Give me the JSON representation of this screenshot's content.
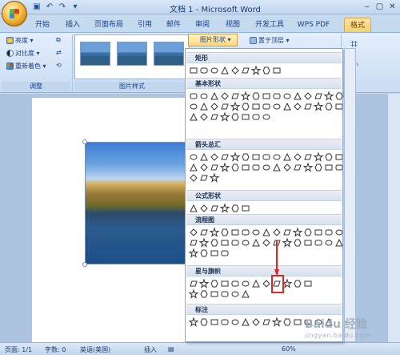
{
  "title": "文档 1 - Microsoft Word",
  "tabs": [
    "开始",
    "插入",
    "页面布局",
    "引用",
    "邮件",
    "审阅",
    "视图",
    "开发工具",
    "WPS PDF",
    "格式"
  ],
  "ribbon": {
    "adjust": {
      "brightness": "亮度",
      "contrast": "对比度",
      "recolor": "重新着色",
      "label": "调整"
    },
    "styles_label": "图片样式",
    "shape_button": "图片形状",
    "bring_front": "置于顶层",
    "size_label": "大小"
  },
  "dropdown": {
    "categories": [
      {
        "name": "矩形"
      },
      {
        "name": "基本形状"
      },
      {
        "name": "箭头总汇"
      },
      {
        "name": "公式形状"
      },
      {
        "name": "流程图"
      },
      {
        "name": "星与旗帜"
      },
      {
        "name": "标注"
      }
    ]
  },
  "status": {
    "page": "页面: 1/1",
    "words": "字数: 0",
    "lang": "英语(美国)",
    "mode": "插入",
    "zoom": "60%"
  },
  "watermark": {
    "text": "Baidu 经验",
    "url": "jingyan.baidu.com"
  }
}
